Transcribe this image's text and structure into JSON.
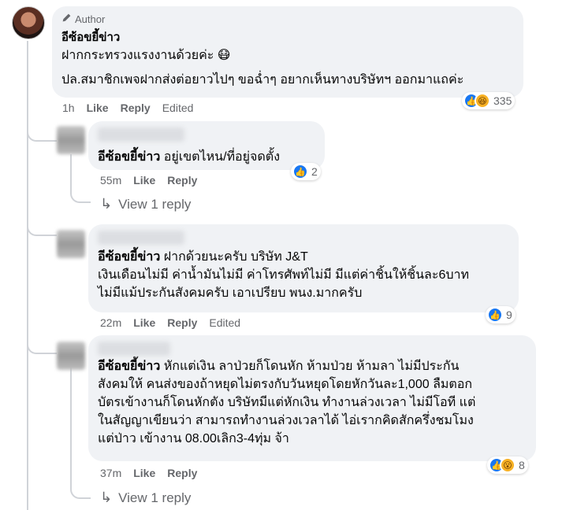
{
  "comments": [
    {
      "badge": "Author",
      "name": "อีซ้อขยี้ข่าว",
      "lines": [
        "ฝากกระทรวงแรงงานด้วยค่ะ 😷",
        "ปล.สมาชิกเพจฝากส่งต่อยาวไปๆ ขอฉ่ำๆ อยากเห็นทางบริษัทฯ ออกมาแถค่ะ"
      ],
      "time": "1h",
      "like": "Like",
      "reply": "Reply",
      "edited": "Edited",
      "reaction_count": "335"
    },
    {
      "mention": "อีซ้อขยี้ข่าว",
      "text": "อยู่เขตไหน/ที่อยู่จดตั้ง",
      "time": "55m",
      "like": "Like",
      "reply": "Reply",
      "reaction_count": "2",
      "view_reply": "View 1 reply"
    },
    {
      "mention": "อีซ้อขยี้ข่าว",
      "lines": [
        "ฝากด้วยนะครับ บริษัท J&T",
        "เงินเดือนไม่มี ค่าน้ำมันไม่มี ค่าโทรศัพท์ไม่มี มีแต่ค่าชิ้นให้ชิ้นละ6บาท",
        "ไม่มีแม้ประกันสังคมครับ เอาเปรียบ พนง.มากครับ"
      ],
      "time": "22m",
      "like": "Like",
      "reply": "Reply",
      "edited": "Edited",
      "reaction_count": "9"
    },
    {
      "mention": "อีซ้อขยี้ข่าว",
      "lines": [
        "หักแต่เงิน ลาป่วยก็โดนหัก ห้ามป่วย ห้ามลา ไม่มีประกัน",
        "สังคมให้ คนส่งของถ้าหยุดไม่ตรงกับวันหยุดโดยหักวันละ1,000 ลืมตอก",
        "บัตรเข้างานก็โดนหักตัง บริษัทมีแต่หักเงิน ทำงานล่วงเวลา ไม่มีโอที แต่",
        "ในสัญญาเขียนว่า สามารถทำงานล่วงเวลาได้ ไอ่เรากคิดสักครึ่งชมโมง",
        "แต่ป่าว เข้างาน 08.00เลิก3-4ทุ่ม จ้า"
      ],
      "time": "37m",
      "like": "Like",
      "reply": "Reply",
      "reaction_count": "8",
      "view_reply": "View 1 reply"
    }
  ],
  "icons": {
    "pencil": "pencil-icon",
    "reply_arrow": "reply-arrow-icon",
    "like": "like-reaction-icon",
    "haha": "haha-reaction-icon",
    "wow": "wow-reaction-icon"
  },
  "colors": {
    "bubble": "#f0f2f5",
    "like_blue": "#1877f2",
    "meta_gray": "#65676b"
  }
}
